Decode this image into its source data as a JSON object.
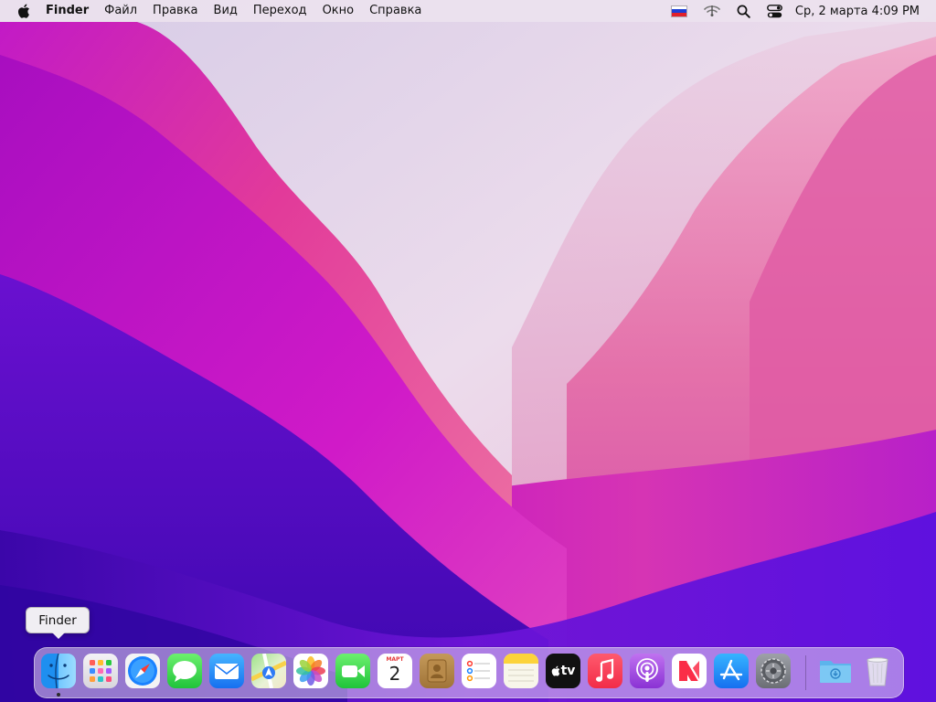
{
  "menubar": {
    "app_name": "Finder",
    "menus": [
      "Файл",
      "Правка",
      "Вид",
      "Переход",
      "Окно",
      "Справка"
    ],
    "clock": "Ср, 2 марта  4:09 PM",
    "input_flag_colors": [
      "#ffffff",
      "#1c3dd6",
      "#e0202a"
    ]
  },
  "tooltip": {
    "text": "Finder"
  },
  "dock": {
    "apps": [
      {
        "name": "finder",
        "icon": "finder-icon",
        "running": true
      },
      {
        "name": "launchpad",
        "icon": "launchpad-icon"
      },
      {
        "name": "safari",
        "icon": "safari-icon"
      },
      {
        "name": "messages",
        "icon": "messages-icon"
      },
      {
        "name": "mail",
        "icon": "mail-icon"
      },
      {
        "name": "maps",
        "icon": "maps-icon"
      },
      {
        "name": "photos",
        "icon": "photos-icon"
      },
      {
        "name": "facetime",
        "icon": "facetime-icon"
      },
      {
        "name": "calendar",
        "icon": "calendar-icon"
      },
      {
        "name": "contacts",
        "icon": "contacts-icon"
      },
      {
        "name": "reminders",
        "icon": "reminders-icon"
      },
      {
        "name": "notes",
        "icon": "notes-icon"
      },
      {
        "name": "tv",
        "icon": "apple-tv-icon"
      },
      {
        "name": "music",
        "icon": "music-icon"
      },
      {
        "name": "podcasts",
        "icon": "podcasts-icon"
      },
      {
        "name": "news",
        "icon": "news-icon"
      },
      {
        "name": "app-store",
        "icon": "app-store-icon"
      },
      {
        "name": "system-preferences",
        "icon": "system-preferences-icon"
      },
      {
        "name": "downloads",
        "icon": "downloads-folder-icon"
      },
      {
        "name": "trash",
        "icon": "trash-icon"
      }
    ],
    "calendar": {
      "month": "МАРТ",
      "day": "2"
    },
    "tv_label": "tv"
  },
  "colors": {
    "wallpaper_violet": "#4a0cc8",
    "wallpaper_magenta": "#c21ac6",
    "wallpaper_pink": "#e06aa8",
    "wallpaper_lavender": "#e6dcee"
  }
}
